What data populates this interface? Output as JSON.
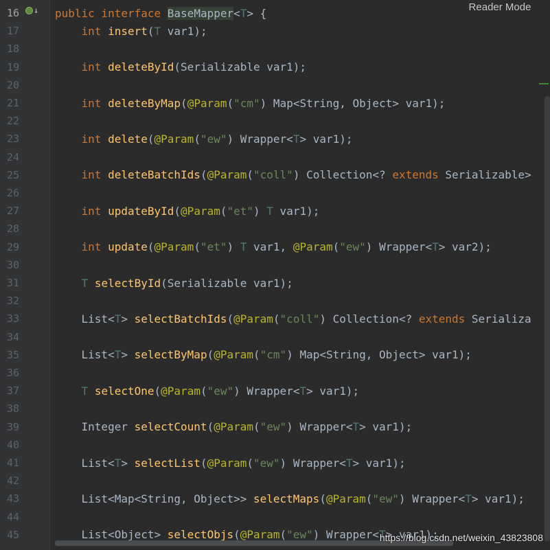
{
  "header": {
    "reader_mode_label": "Reader Mode"
  },
  "gutter_icons": [
    "implemented-icon",
    "down-arrow-icon"
  ],
  "watermark": "https://blog.csdn.net/weixin_43823808",
  "lines": [
    {
      "num": "16",
      "code": "public interface BaseMapper<T> {"
    },
    {
      "num": "17",
      "code": "    int insert(T var1);"
    },
    {
      "num": "18",
      "code": ""
    },
    {
      "num": "19",
      "code": "    int deleteById(Serializable var1);"
    },
    {
      "num": "20",
      "code": ""
    },
    {
      "num": "21",
      "code": "    int deleteByMap(@Param(\"cm\") Map<String, Object> var1);"
    },
    {
      "num": "22",
      "code": ""
    },
    {
      "num": "23",
      "code": "    int delete(@Param(\"ew\") Wrapper<T> var1);"
    },
    {
      "num": "24",
      "code": ""
    },
    {
      "num": "25",
      "code": "    int deleteBatchIds(@Param(\"coll\") Collection<? extends Serializable>"
    },
    {
      "num": "26",
      "code": ""
    },
    {
      "num": "27",
      "code": "    int updateById(@Param(\"et\") T var1);"
    },
    {
      "num": "28",
      "code": ""
    },
    {
      "num": "29",
      "code": "    int update(@Param(\"et\") T var1, @Param(\"ew\") Wrapper<T> var2);"
    },
    {
      "num": "30",
      "code": ""
    },
    {
      "num": "31",
      "code": "    T selectById(Serializable var1);"
    },
    {
      "num": "32",
      "code": ""
    },
    {
      "num": "33",
      "code": "    List<T> selectBatchIds(@Param(\"coll\") Collection<? extends Serializa"
    },
    {
      "num": "34",
      "code": ""
    },
    {
      "num": "35",
      "code": "    List<T> selectByMap(@Param(\"cm\") Map<String, Object> var1);"
    },
    {
      "num": "36",
      "code": ""
    },
    {
      "num": "37",
      "code": "    T selectOne(@Param(\"ew\") Wrapper<T> var1);"
    },
    {
      "num": "38",
      "code": ""
    },
    {
      "num": "39",
      "code": "    Integer selectCount(@Param(\"ew\") Wrapper<T> var1);"
    },
    {
      "num": "40",
      "code": ""
    },
    {
      "num": "41",
      "code": "    List<T> selectList(@Param(\"ew\") Wrapper<T> var1);"
    },
    {
      "num": "42",
      "code": ""
    },
    {
      "num": "43",
      "code": "    List<Map<String, Object>> selectMaps(@Param(\"ew\") Wrapper<T> var1);"
    },
    {
      "num": "44",
      "code": ""
    },
    {
      "num": "45",
      "code": "    List<Object> selectObjs(@Param(\"ew\") Wrapper<T> var1);"
    }
  ]
}
